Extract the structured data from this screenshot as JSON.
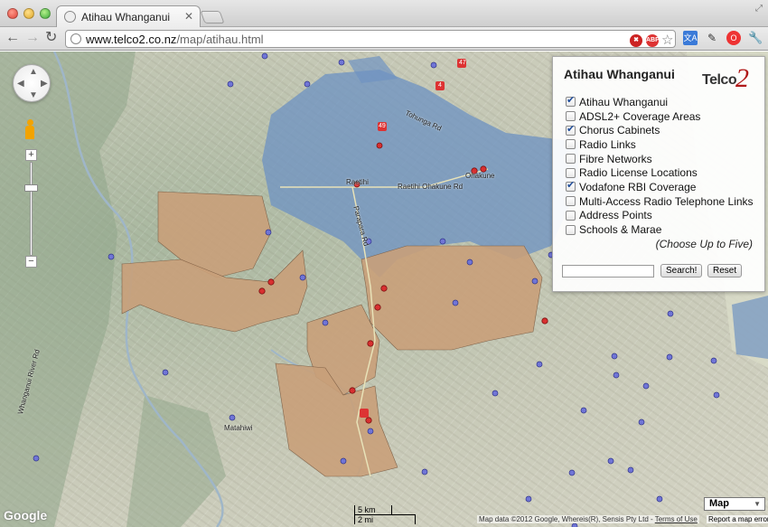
{
  "browser": {
    "tab_title": "Atihau Whanganui",
    "tab_close": "✕",
    "url_host": "www.telco2.co.nz",
    "url_path": "/map/atihau.html",
    "ext1": "✖",
    "ext2": "ABP",
    "star": "☆",
    "translate": "文A",
    "wrench": "🔧"
  },
  "panel": {
    "title": "Atihau Whanganui",
    "logo_text": "Telco",
    "logo_two": "2",
    "layers": [
      {
        "label": "Atihau Whanganui",
        "checked": true
      },
      {
        "label": "ADSL2+ Coverage Areas",
        "checked": false
      },
      {
        "label": "Chorus Cabinets",
        "checked": true
      },
      {
        "label": "Radio Links",
        "checked": false
      },
      {
        "label": "Fibre Networks",
        "checked": false
      },
      {
        "label": "Radio License Locations",
        "checked": false
      },
      {
        "label": "Vodafone RBI Coverage",
        "checked": true
      },
      {
        "label": "Multi-Access Radio Telephone Links",
        "checked": false
      },
      {
        "label": "Address Points",
        "checked": false
      },
      {
        "label": "Schools & Marae",
        "checked": false
      }
    ],
    "choose_note": "(Choose Up to Five)",
    "search_value": "",
    "search_button": "Search!",
    "reset_button": "Reset"
  },
  "map": {
    "map_type": "Map",
    "google_label": "Google",
    "scale_km": "5 km",
    "scale_mi": "2 mi",
    "attribution": "Map data ©2012 Google, Whereis(R), Sensis Pty Ltd -",
    "terms_link": "Terms of Use",
    "report_link": "Report a map error",
    "places": {
      "ohakune": "Ohakune",
      "raetihi": "Raetihi",
      "raetihi_ohakune_rd": "Raetihi Ohakune Rd",
      "parapara_rd": "Parapara Rd",
      "matahiwi": "Matahiwi",
      "tohunga_rd": "Tohunga Rd",
      "whanganui_river_rd": "Whanganui River Rd",
      "road_47": "47",
      "road_4": "4",
      "road_49": "49"
    },
    "colors": {
      "atihau_fill": "#c9a07a",
      "vodafone_fill": "#6f93c2",
      "cabinet_dot": "#d83030",
      "address_dot": "#6f75d8"
    }
  }
}
